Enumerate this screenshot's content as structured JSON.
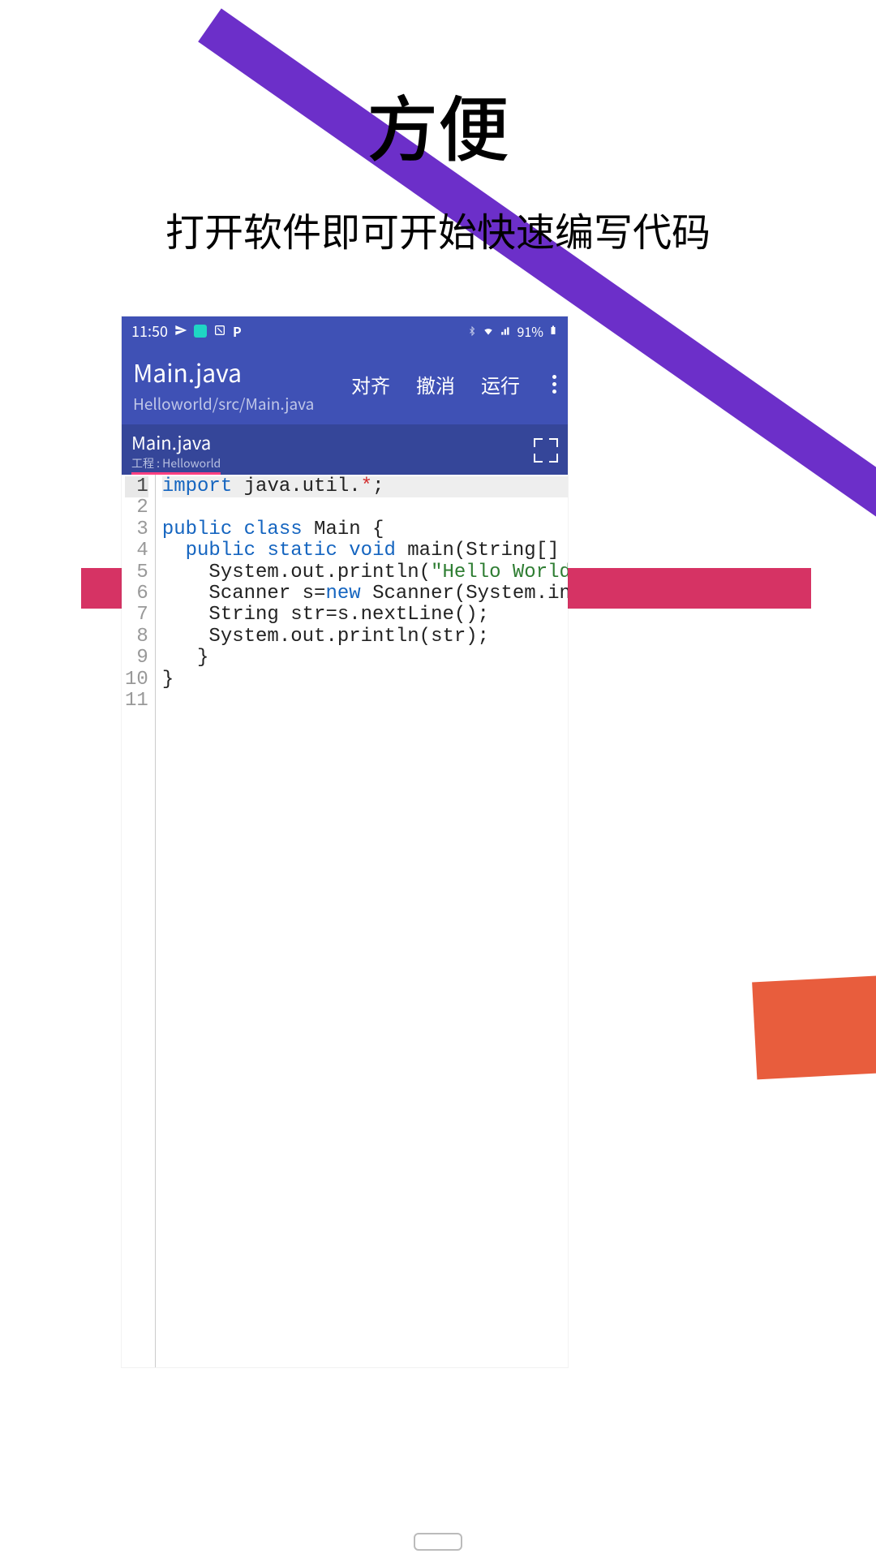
{
  "hero": {
    "title": "方便",
    "subtitle": "打开软件即可开始快速编写代码"
  },
  "statusBar": {
    "time": "11:50",
    "battery": "91%"
  },
  "appBar": {
    "title": "Main.java",
    "path": "Helloworld/src/Main.java",
    "actions": {
      "align": "对齐",
      "undo": "撤消",
      "run": "运行"
    }
  },
  "tab": {
    "name": "Main.java",
    "projectLabel": "工程 : Helloworld"
  },
  "code": {
    "lineNumbers": [
      "1",
      "2",
      "3",
      "4",
      "5",
      "6",
      "7",
      "8",
      "9",
      "10",
      "11"
    ],
    "currentLine": 1,
    "lines": [
      {
        "tokens": [
          {
            "t": "import ",
            "c": "kw"
          },
          {
            "t": "java.util.",
            "c": "plain"
          },
          {
            "t": "*",
            "c": "op"
          },
          {
            "t": ";",
            "c": "plain"
          }
        ]
      },
      {
        "tokens": []
      },
      {
        "tokens": [
          {
            "t": "public class ",
            "c": "kw"
          },
          {
            "t": "Main {",
            "c": "plain"
          }
        ]
      },
      {
        "tokens": [
          {
            "t": "  ",
            "c": "plain"
          },
          {
            "t": "public static void ",
            "c": "kw"
          },
          {
            "t": "main(String[]",
            "c": "plain"
          }
        ]
      },
      {
        "tokens": [
          {
            "t": "    System.out.println(",
            "c": "plain"
          },
          {
            "t": "\"Hello World",
            "c": "str"
          }
        ]
      },
      {
        "tokens": [
          {
            "t": "    Scanner s=",
            "c": "plain"
          },
          {
            "t": "new ",
            "c": "kw"
          },
          {
            "t": "Scanner(System.in",
            "c": "plain"
          }
        ]
      },
      {
        "tokens": [
          {
            "t": "    String str=s.nextLine();",
            "c": "plain"
          }
        ]
      },
      {
        "tokens": [
          {
            "t": "    System.out.println(str);",
            "c": "plain"
          }
        ]
      },
      {
        "tokens": [
          {
            "t": "   }",
            "c": "plain"
          }
        ]
      },
      {
        "tokens": [
          {
            "t": "}",
            "c": "plain"
          }
        ]
      },
      {
        "tokens": []
      }
    ]
  }
}
